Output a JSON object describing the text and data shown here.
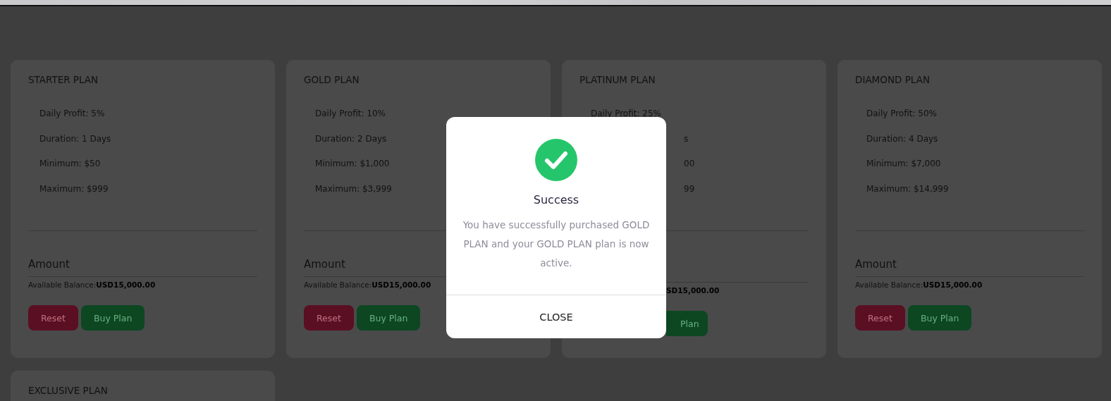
{
  "plans": [
    {
      "kind": "full",
      "title": "STARTER PLAN",
      "features": [
        "Daily Profit: 5%",
        "Duration: 1 Days",
        "Minimum: $50",
        "Maximum: $999"
      ],
      "amount_placeholder": "Amount",
      "balance_label": "Available Balance:",
      "balance": "USD15,000.00",
      "buttons": [
        {
          "kind": "reset",
          "label": "Reset"
        },
        {
          "kind": "buy",
          "label": "Buy Plan"
        }
      ]
    },
    {
      "kind": "full",
      "title": "GOLD PLAN",
      "features": [
        "Daily Profit: 10%",
        "Duration: 2 Days",
        "Minimum: $1,000",
        "Maximum: $3,999"
      ],
      "amount_placeholder": "Amount",
      "balance_label": "Available Balance:",
      "balance": "USD15,000.00",
      "buttons": [
        {
          "kind": "reset",
          "label": "Reset"
        },
        {
          "kind": "buy",
          "label": "Buy Plan"
        }
      ]
    },
    {
      "kind": "covered",
      "title": "PLATINUM PLAN",
      "features": [
        "Daily Profit: 25%",
        "s",
        "00",
        "99"
      ],
      "balance": "SD15,000.00",
      "buttons": [
        {
          "kind": "buy",
          "label": "Plan"
        }
      ]
    },
    {
      "kind": "full",
      "title": "DIAMOND PLAN",
      "features": [
        "Daily Profit: 50%",
        "Duration: 4 Days",
        "Minimum: $7,000",
        "Maximum: $14,999"
      ],
      "amount_placeholder": "Amount",
      "balance_label": "Available Balance:",
      "balance": "USD15,000.00",
      "buttons": [
        {
          "kind": "reset",
          "label": "Reset"
        },
        {
          "kind": "buy",
          "label": "Buy Plan"
        }
      ]
    },
    {
      "kind": "title_only",
      "title": "EXCLUSIVE PLAN"
    }
  ],
  "dialog": {
    "title": "Success",
    "message": "You have successfully purchased GOLD PLAN and your GOLD PLAN plan is now active.",
    "button": "CLOSE"
  }
}
